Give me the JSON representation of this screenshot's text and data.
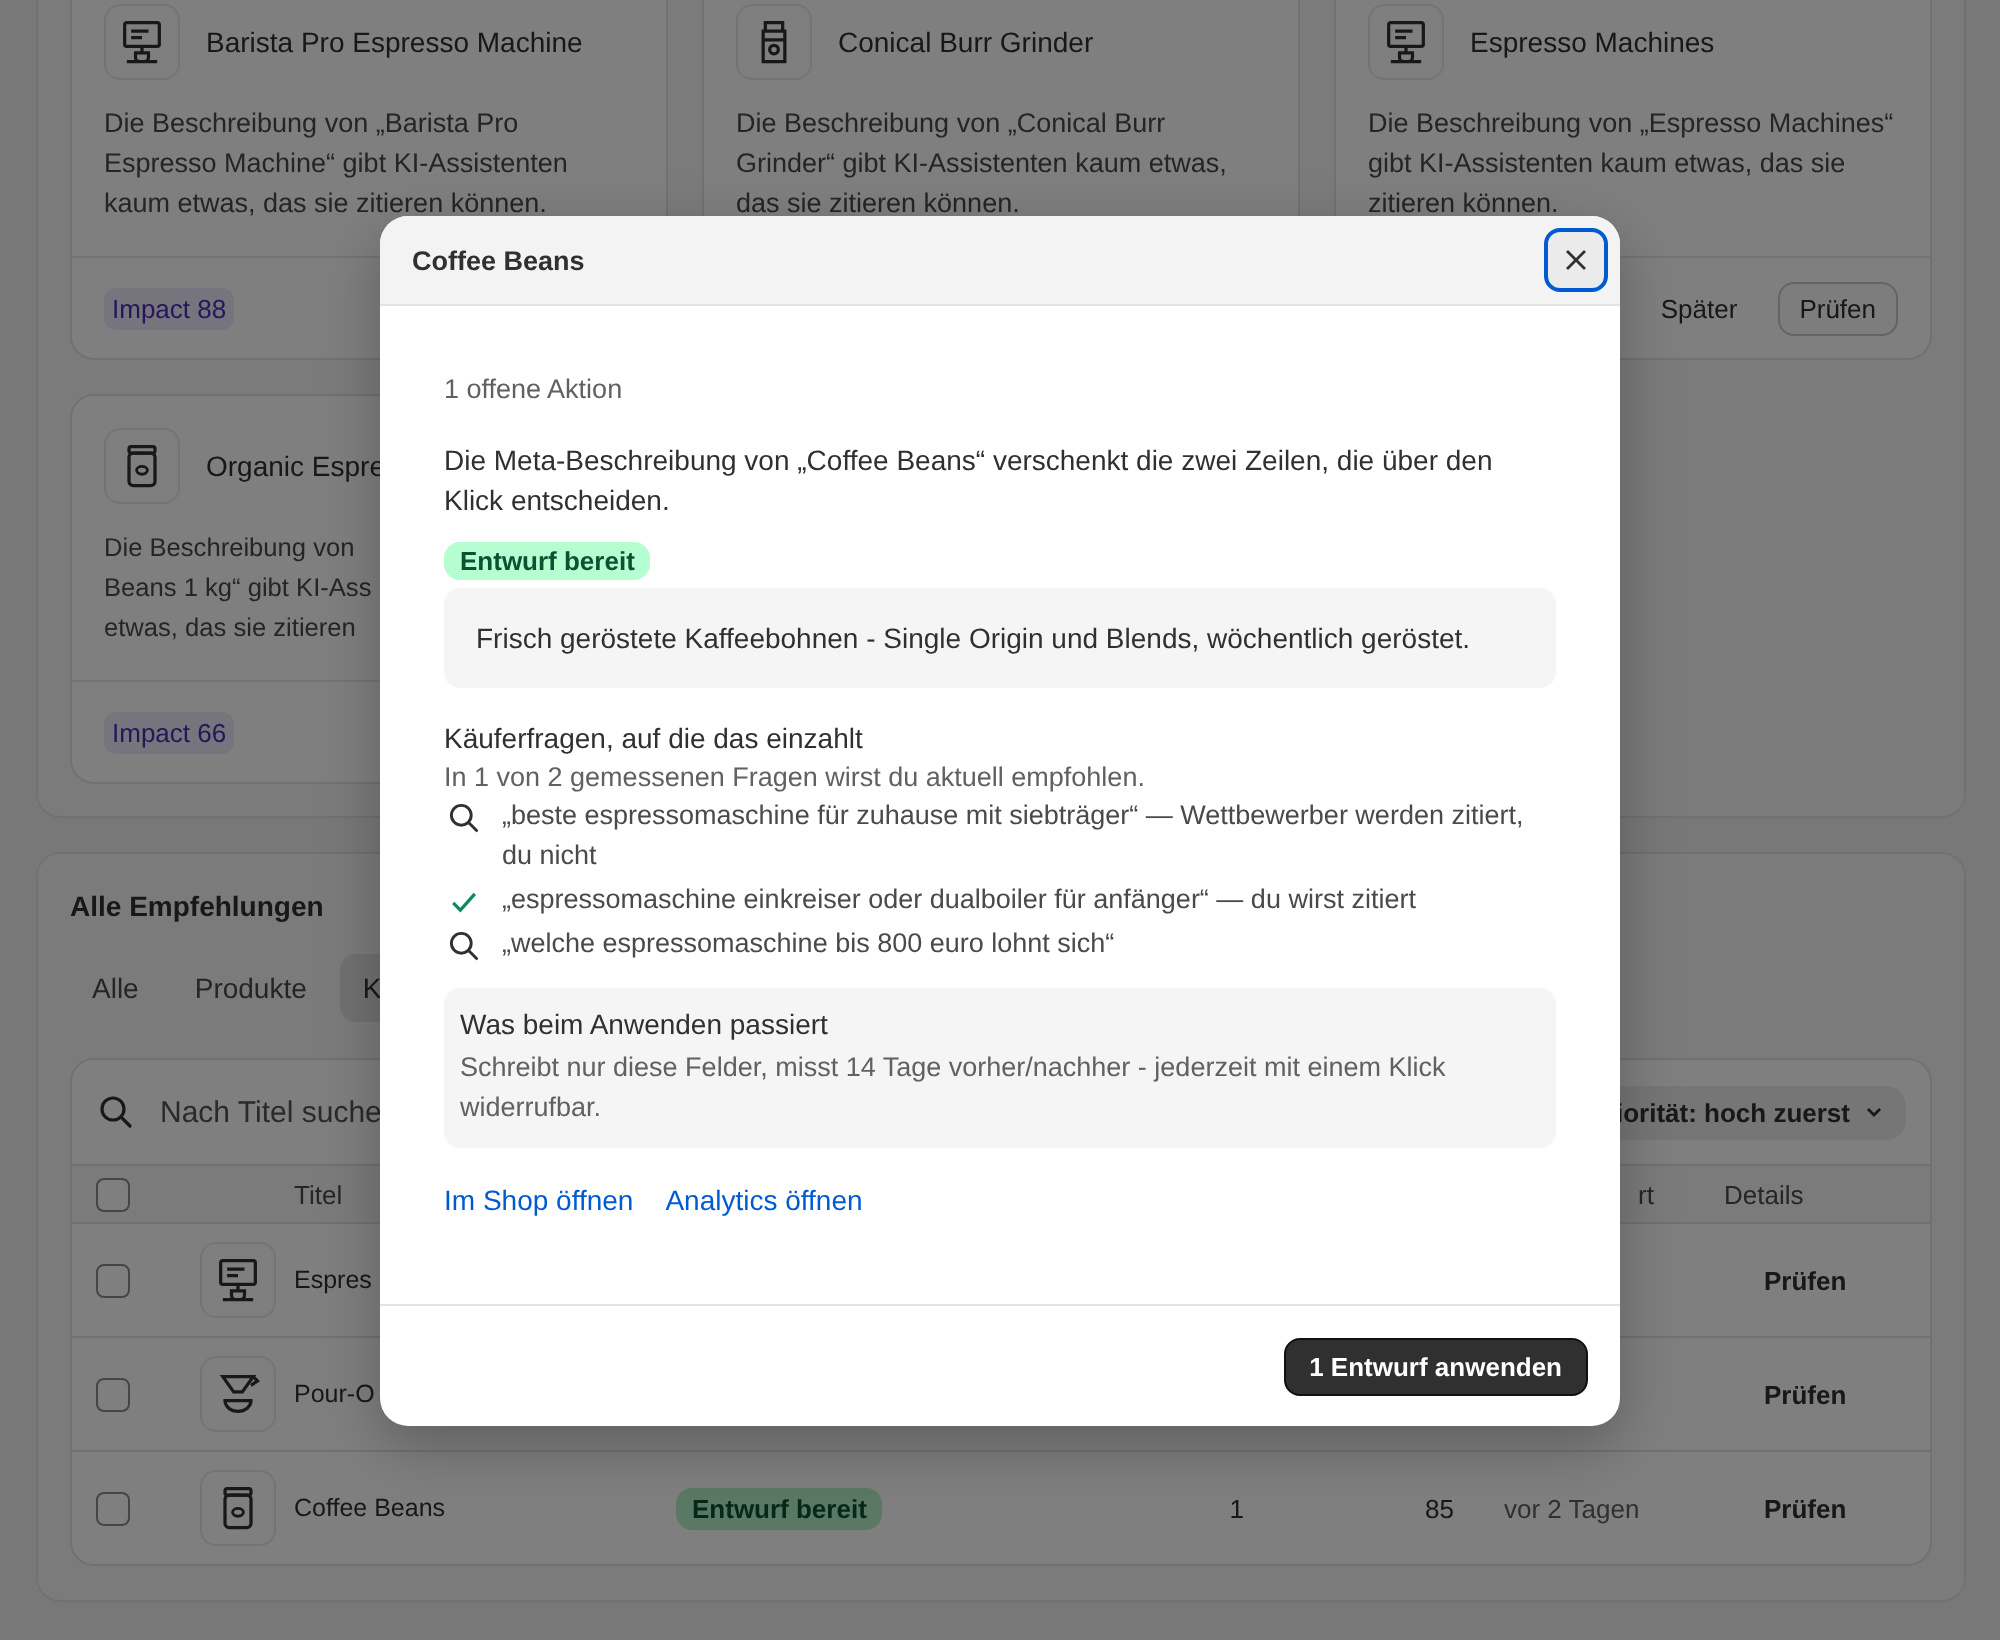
{
  "top_cards": [
    {
      "kind": "machine",
      "title": "Barista Pro Espresso Machine",
      "description": "Die Beschreibung von „Barista Pro Espresso Machine“ gibt KI-Assistenten kaum etwas, das sie zitieren können.",
      "impact": "Impact 88"
    },
    {
      "kind": "grinder",
      "title": "Conical Burr Grinder",
      "description": "Die Beschreibung von „Conical Burr Grinder“ gibt KI-Assistenten kaum etwas, das sie zitieren können."
    },
    {
      "kind": "machine",
      "title": "Espresso Machines",
      "description": "Die Beschreibung von „Espresso Machines“ gibt KI-Assistenten kaum etwas, das sie zitieren können.",
      "actions": [
        {
          "kind": "plain",
          "label": "Später"
        },
        {
          "kind": "outlined",
          "label": "Prüfen"
        }
      ]
    },
    {
      "kind": "beans",
      "title": "Organic Espre",
      "description_lines": [
        "Die Beschreibung von",
        "Beans 1 kg“ gibt KI-Ass",
        "etwas, das sie zitieren"
      ],
      "impact": "Impact 66"
    }
  ],
  "recommendations": {
    "title": "Alle Empfehlungen",
    "tabs": [
      {
        "label": "Alle",
        "selected": false
      },
      {
        "label": "Produkte",
        "selected": false
      },
      {
        "label": "K",
        "selected": true
      }
    ],
    "search": {
      "placeholder": "Nach Titel suche"
    },
    "sort": {
      "label": "iorität: hoch zuerst"
    },
    "header": {
      "checked": false,
      "title": "Titel",
      "column_7": "rt",
      "details": "Details"
    },
    "rows": [
      {
        "checked": false,
        "kind": "machine",
        "title": "Espres",
        "details": "Prüfen"
      },
      {
        "checked": false,
        "kind": "dripper",
        "title": "Pour-O",
        "details": "Prüfen"
      },
      {
        "checked": false,
        "kind": "beans",
        "title": "Coffee Beans",
        "status": "Entwurf bereit",
        "column_5": "1",
        "column_6": "85",
        "column_7": "vor 2 Tagen",
        "details": "Prüfen"
      }
    ]
  },
  "modal": {
    "title": "Coffee Beans",
    "count": "1 offene Aktion",
    "message": "Die Meta-Beschreibung von „Coffee Beans“ verschenkt die zwei Zeilen, die über den Klick entscheiden.",
    "badge": "Entwurf bereit",
    "draft": "Frisch geröstete Kaffeebohnen - Single Origin und Blends, wöchentlich geröstet.",
    "questions_title": "Käuferfragen, auf die das einzahlt",
    "questions_summary": "In 1 von 2 gemessenen Fragen wirst du aktuell empfohlen.",
    "questions": [
      {
        "kind": "not_cited",
        "text": "„beste espressomaschine für zuhause mit siebträger“ — Wettbewerber werden zitiert, du nicht"
      },
      {
        "kind": "cited",
        "text": "„espressomaschine einkreiser oder dualboiler für anfänger“ — du wirst zitiert"
      },
      {
        "kind": "not_cited",
        "text": "„welche espressomaschine bis 800 euro lohnt sich“"
      }
    ],
    "info_title": "Was beim Anwenden passiert",
    "info_text": "Schreibt nur diese Felder, misst 14 Tage vorher/nachher - jederzeit mit einem Klick widerrufbar.",
    "links": [
      "Im Shop öffnen",
      "Analytics öffnen"
    ],
    "apply_button": "1 Entwurf anwenden"
  }
}
